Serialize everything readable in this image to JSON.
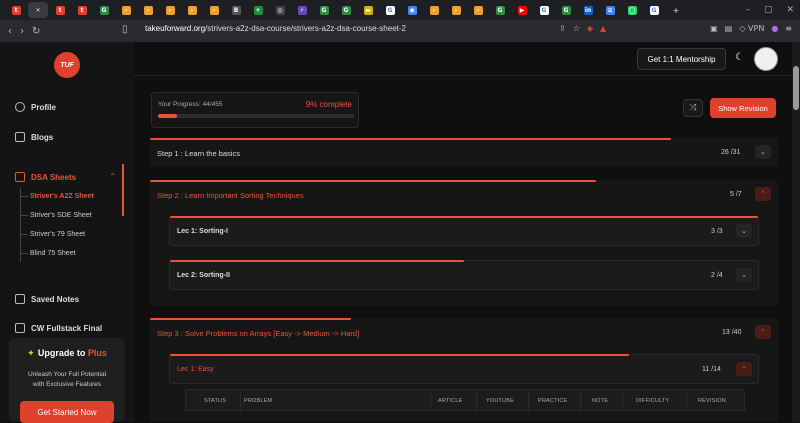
{
  "browser": {
    "tabs": [
      {
        "icon": "tuf-favicon",
        "color": "#e0412c",
        "glyph": "t"
      },
      {
        "icon": "close-icon",
        "color": "#3a3b3f",
        "glyph": "✕"
      },
      {
        "icon": "tuf-favicon",
        "color": "#e0412c",
        "glyph": "t"
      },
      {
        "icon": "tuf-favicon",
        "color": "#e0412c",
        "glyph": "t"
      },
      {
        "icon": "gfg-favicon",
        "color": "#2f8d46",
        "glyph": "G"
      },
      {
        "icon": "code-favicon",
        "color": "#f0a030",
        "glyph": "›"
      },
      {
        "icon": "code-favicon",
        "color": "#f0a030",
        "glyph": "›"
      },
      {
        "icon": "code-favicon",
        "color": "#f0a030",
        "glyph": "›"
      },
      {
        "icon": "code-favicon",
        "color": "#f0a030",
        "glyph": "›"
      },
      {
        "icon": "code-favicon",
        "color": "#f0a030",
        "glyph": "›"
      },
      {
        "icon": "doc-favicon",
        "color": "#555555",
        "glyph": "B"
      },
      {
        "icon": "sheet-favicon",
        "color": "#1e8e3e",
        "glyph": "+"
      },
      {
        "icon": "chatgpt-favicon",
        "color": "#444444",
        "glyph": "◎"
      },
      {
        "icon": "ext-favicon",
        "color": "#6b46c1",
        "glyph": "⚡"
      },
      {
        "icon": "gfg-favicon",
        "color": "#2f8d46",
        "glyph": "G"
      },
      {
        "icon": "gfg-favicon",
        "color": "#2f8d46",
        "glyph": "G"
      },
      {
        "icon": "yellow-favicon",
        "color": "#d4b106",
        "glyph": "▬"
      },
      {
        "icon": "google-favicon",
        "color": "#ffffff",
        "glyph": "G"
      },
      {
        "icon": "chrome-favicon",
        "color": "#4285f4",
        "glyph": "◉"
      },
      {
        "icon": "code-favicon",
        "color": "#f0a030",
        "glyph": "›"
      },
      {
        "icon": "code-favicon",
        "color": "#f0a030",
        "glyph": "›"
      },
      {
        "icon": "code-favicon",
        "color": "#f0a030",
        "glyph": "›"
      },
      {
        "icon": "gfg-favicon",
        "color": "#2f8d46",
        "glyph": "G"
      },
      {
        "icon": "youtube-favicon",
        "color": "#ff0000",
        "glyph": "▶"
      },
      {
        "icon": "google-favicon",
        "color": "#ffffff",
        "glyph": "G"
      },
      {
        "icon": "gfg-favicon",
        "color": "#2f8d46",
        "glyph": "G"
      },
      {
        "icon": "linkedin-favicon",
        "color": "#0a66c2",
        "glyph": "in"
      },
      {
        "icon": "docs-favicon",
        "color": "#4285f4",
        "glyph": "≡"
      },
      {
        "icon": "whatsapp-favicon",
        "color": "#25d366",
        "glyph": "◯"
      },
      {
        "icon": "google-favicon",
        "color": "#ffffff",
        "glyph": "G"
      }
    ],
    "new_tab_glyph": "+",
    "url_host": "takeuforward.org",
    "url_path": "/strivers-a2z-dsa-course/strivers-a2z-dsa-course-sheet-2",
    "vpn_label": "VPN"
  },
  "sidebar": {
    "logo_text": "TUF",
    "profile_label": "Profile",
    "blogs_label": "Blogs",
    "dsa_sheets_label": "DSA Sheets",
    "sheets": [
      {
        "label": "Striver's A2Z Sheet",
        "active": true
      },
      {
        "label": "Striver's SDE Sheet",
        "active": false
      },
      {
        "label": "Striver's 79 Sheet",
        "active": false
      },
      {
        "label": "Blind 75 Sheet",
        "active": false
      }
    ],
    "saved_notes_label": "Saved Notes",
    "cw_label": "CW Fullstack Final",
    "upgrade": {
      "title_prefix": "Upgrade to ",
      "title_plus": "Plus",
      "line1": "Unleash Your Full Potential",
      "line2": "with Exclusive Features",
      "button": "Get Started Now"
    }
  },
  "header": {
    "mentorship_label": "Get 1:1 Mentorship"
  },
  "progress": {
    "label": "Your Progress: 44/455",
    "percent_label": "9% complete",
    "fraction": 0.097
  },
  "actions": {
    "show_revision_label": "Show Revision"
  },
  "steps": [
    {
      "title": "Step 1 : Learn the basics",
      "count": "26 /31",
      "progress": 0.83,
      "open": false
    },
    {
      "title": "Step 2 : Learn Important Sorting Techniques",
      "count": "5 /7",
      "progress": 0.71,
      "open": true,
      "lectures": [
        {
          "title": "Lec 1: Sorting-I",
          "count": "3 /3",
          "progress": 1.0
        },
        {
          "title": "Lec 2: Sorting-II",
          "count": "2 /4",
          "progress": 0.5
        }
      ]
    },
    {
      "title": "Step 3 : Solve Problems on Arrays [Easy -> Medium -> Hard]",
      "count": "13 /40",
      "progress": 0.32,
      "open": true,
      "lectures": [
        {
          "title": "Lec 1: Easy",
          "count": "11 /14",
          "progress": 0.78,
          "open": true
        }
      ]
    }
  ],
  "table": {
    "headers": [
      "STATUS",
      "PROBLEM",
      "ARTICLE",
      "YOUTUBE",
      "PRACTICE",
      "NOTE",
      "DIFFICULTY",
      "REVISION"
    ]
  },
  "colors": {
    "accent": "#e8543a",
    "background": "#0d0d0d"
  }
}
